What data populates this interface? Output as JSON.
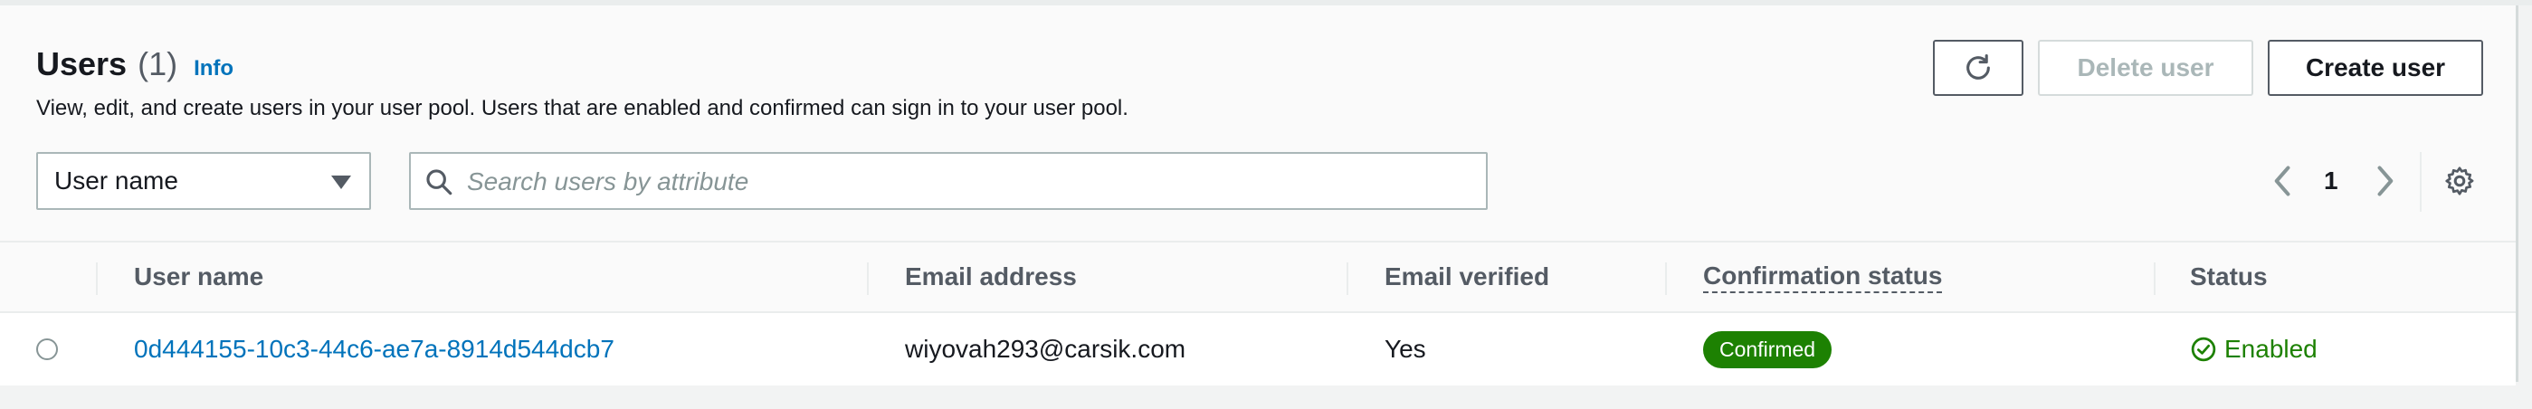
{
  "header": {
    "title": "Users",
    "count": "(1)",
    "info": "Info",
    "description": "View, edit, and create users in your user pool. Users that are enabled and confirmed can sign in to your user pool."
  },
  "actions": {
    "refresh_icon": "refresh-icon",
    "delete": "Delete user",
    "create": "Create user"
  },
  "filter": {
    "attribute": "User name",
    "search_placeholder": "Search users by attribute",
    "search_value": ""
  },
  "pagination": {
    "current_page": "1"
  },
  "table": {
    "columns": [
      "User name",
      "Email address",
      "Email verified",
      "Confirmation status",
      "Status"
    ],
    "rows": [
      {
        "user_name": "0d444155-10c3-44c6-ae7a-8914d544dcb7",
        "email": "wiyovah293@carsik.com",
        "email_verified": "Yes",
        "confirmation_status": "Confirmed",
        "status": "Enabled"
      }
    ]
  },
  "colors": {
    "link": "#0073bb",
    "success": "#1d8102",
    "disabled_text": "#aab7b8"
  }
}
